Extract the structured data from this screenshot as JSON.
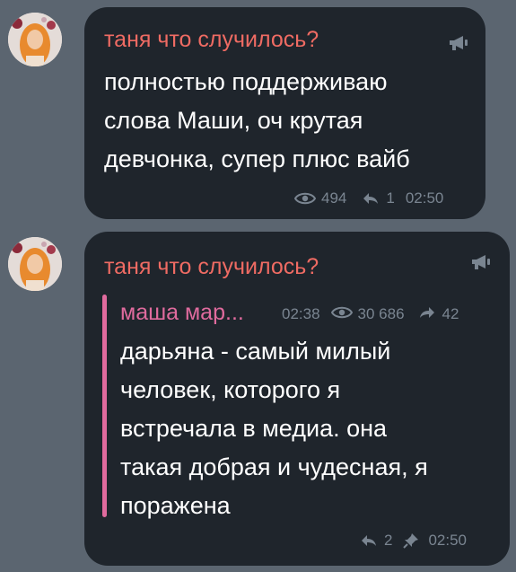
{
  "messages": [
    {
      "sender": "таня что случилось?",
      "avatar_icon": "user-avatar-photo",
      "channel_icon": "megaphone-icon",
      "text_lines": [
        "полностью поддерживаю",
        "слова Маши, оч крутая",
        "девчонка, супер плюс вайб"
      ],
      "views": "494",
      "replies": "1",
      "time": "02:50"
    },
    {
      "sender": "таня что случилось?",
      "avatar_icon": "user-avatar-photo",
      "channel_icon": "megaphone-icon",
      "forward": {
        "sender": "маша мар...",
        "time": "02:38",
        "views": "30 686",
        "shares": "42",
        "text_lines": [
          "дарьяна - самый милый",
          "человек, которого я",
          "встречала в медиа. она",
          "такая добрая и чудесная, я",
          "поражена"
        ]
      },
      "replies": "2",
      "pin_icon": "pin-icon",
      "time": "02:50"
    }
  ],
  "colors": {
    "background": "#5b6570",
    "bubble": "#1f252c",
    "sender": "#ef6b63",
    "forward_accent": "#e06b9e",
    "meta": "#7a8591",
    "text": "#ffffff"
  }
}
